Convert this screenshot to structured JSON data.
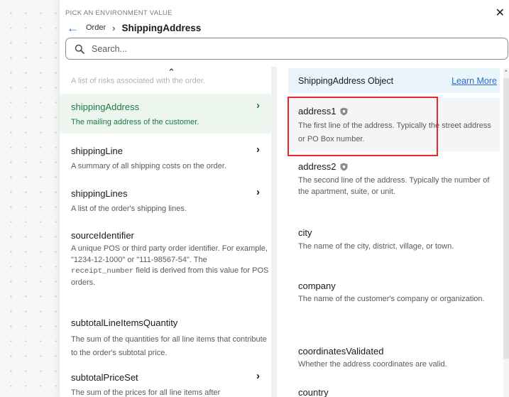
{
  "header": {
    "kicker": "PICK AN ENVIRONMENT VALUE",
    "breadcrumb_parent": "Order",
    "breadcrumb_separator": "›",
    "breadcrumb_current": "ShippingAddress",
    "close_symbol": "✕",
    "back_symbol": "←"
  },
  "search": {
    "placeholder": "Search...",
    "value": ""
  },
  "left_list": {
    "faded_text": "A list of risks associated with the order.",
    "up_symbol": "⌃",
    "chevron": "›",
    "items": [
      {
        "name": "shippingAddress",
        "description": "The mailing address of the customer.",
        "has_chevron": true,
        "selected": true
      },
      {
        "name": "shippingLine",
        "description": "A summary of all shipping costs on the order.",
        "has_chevron": true,
        "selected": false
      },
      {
        "name": "shippingLines",
        "description": "A list of the order's shipping lines.",
        "has_chevron": true,
        "selected": false
      },
      {
        "name": "sourceIdentifier",
        "description_parts": [
          "A unique POS or third party order identifier. For example, \"1234-12-1000\" or \"111-98567-54\". The ",
          "receipt_number",
          " field is derived from this value for POS orders."
        ],
        "has_chevron": false,
        "selected": false
      },
      {
        "name": "subtotalLineItemsQuantity",
        "description": "The sum of the quantities for all line items that contribute to the order's subtotal price.",
        "has_chevron": false,
        "selected": false
      },
      {
        "name": "subtotalPriceSet",
        "description": "The sum of the prices for all line items after",
        "has_chevron": true,
        "selected": false
      }
    ]
  },
  "right_panel": {
    "title": "ShippingAddress Object",
    "learn_more": "Learn More",
    "fields": [
      {
        "name": "address1",
        "description": "The first line of the address. Typically the street address or PO Box number.",
        "icon": "shield-icon"
      },
      {
        "name": "address2",
        "description": "The second line of the address. Typically the number of the apartment, suite, or unit.",
        "icon": "shield-icon"
      },
      {
        "name": "city",
        "description": "The name of the city, district, village, or town."
      },
      {
        "name": "company",
        "description": "The name of the customer's company or organization."
      },
      {
        "name": "coordinatesValidated",
        "description": "Whether the address coordinates are valid."
      },
      {
        "name": "country",
        "description": ""
      }
    ]
  },
  "colors": {
    "accent_blue": "#2c6ecb",
    "selected_green": "#1a7a41",
    "selected_bg": "#edf5ef",
    "highlight_box": "#e8262b",
    "header_bg": "#eaf4fb"
  }
}
